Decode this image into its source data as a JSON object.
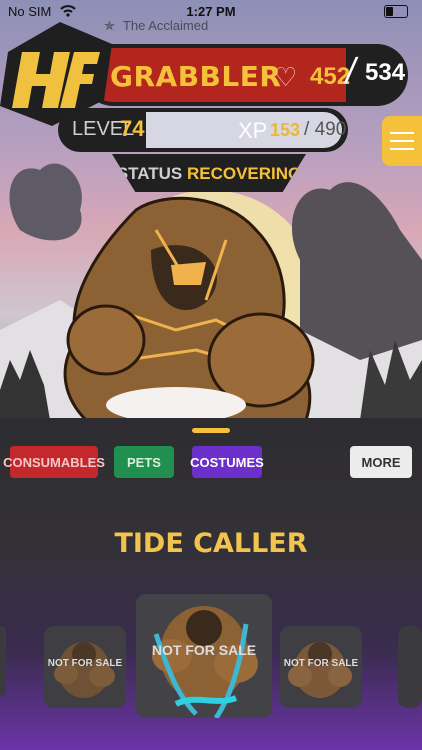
{
  "status_bar": {
    "carrier": "No SIM",
    "time": "1:27 PM"
  },
  "header": {
    "subtitle": "The Acclaimed",
    "name": "GRABBLER",
    "hp_current": "452",
    "hp_max": "534",
    "level_label": "LEVEL",
    "level_value": "74",
    "xp_label": "XP",
    "xp_current": "153",
    "xp_max": "490",
    "status_label": "STATUS",
    "status_value": "RECOVERING"
  },
  "tabs": {
    "consumables": "CONSUMABLES",
    "pets": "PETS",
    "costumes": "COSTUMES",
    "more": "MORE"
  },
  "costume": {
    "title": "TIDE CALLER",
    "badge": "NOT FOR SALE"
  },
  "colors": {
    "accent": "#f5c13a",
    "hp_red": "#b3261e",
    "costumes_tab": "#6d2fc9",
    "pets_tab": "#208f4f",
    "consumables_tab": "#c3282c"
  },
  "icons": [
    "wifi-icon",
    "battery-icon",
    "star-icon",
    "heart-icon",
    "menu-icon",
    "logo-hf"
  ]
}
